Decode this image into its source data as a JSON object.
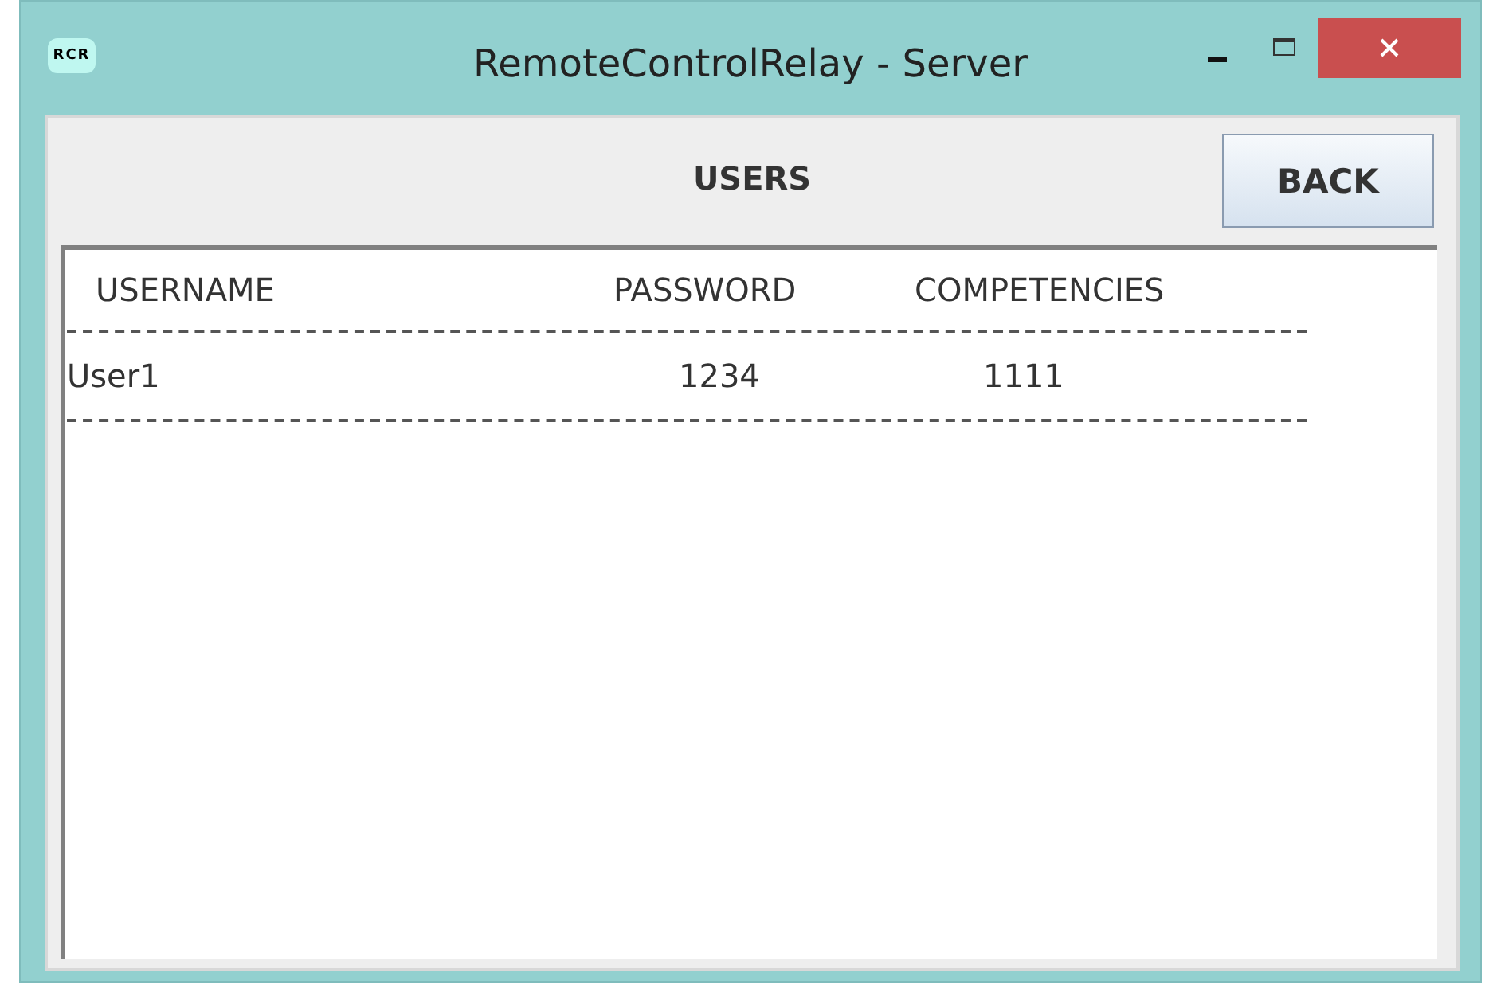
{
  "window": {
    "title": "RemoteControlRelay - Server",
    "icon_text": "RCR"
  },
  "panel": {
    "title": "USERS",
    "back_button": "BACK"
  },
  "table": {
    "columns": [
      "USERNAME",
      "PASSWORD",
      "COMPETENCIES"
    ],
    "rows": [
      {
        "cells": [
          "User1",
          "1234",
          "1111"
        ]
      }
    ]
  }
}
